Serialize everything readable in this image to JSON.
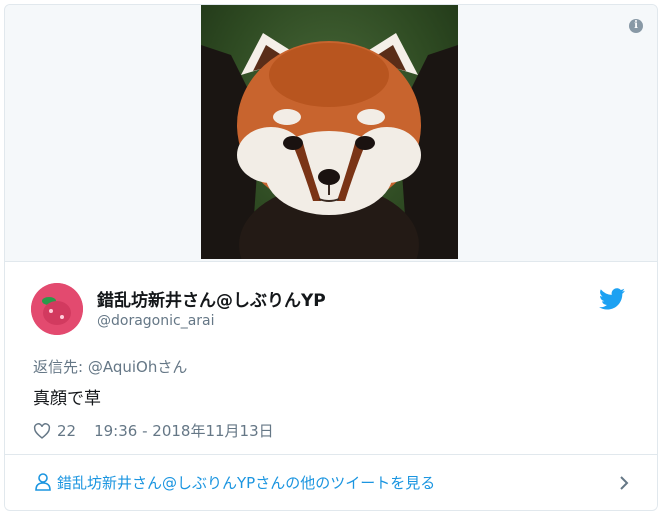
{
  "card": {
    "info_icon": "info-icon",
    "media": {
      "alt_subject": "red panda",
      "icon": "red-panda-photo"
    }
  },
  "author": {
    "name": "錯乱坊新井さん@しぶりんYP",
    "handle": "@doragonic_arai",
    "avatar_color": "#e34a6f"
  },
  "brand": {
    "icon": "twitter-bird-icon",
    "color": "#1da1f2"
  },
  "tweet": {
    "reply_prefix": "返信先: ",
    "reply_mention": "@AquiOhさん",
    "text": "真顔で草",
    "likes": "22",
    "timestamp": "19:36 - 2018年11月13日"
  },
  "footer": {
    "link_text": "錯乱坊新井さん@しぶりんYPさんの他のツイートを見る",
    "link_color": "#1b95e0"
  }
}
